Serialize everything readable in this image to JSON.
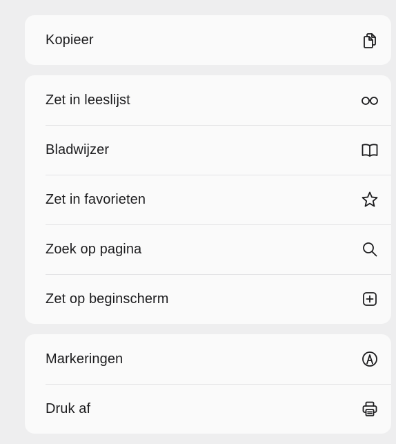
{
  "groups": [
    {
      "items": [
        {
          "label": "Kopieer",
          "icon": "copy-icon"
        }
      ]
    },
    {
      "items": [
        {
          "label": "Zet in leeslijst",
          "icon": "glasses-icon"
        },
        {
          "label": "Bladwijzer",
          "icon": "book-icon"
        },
        {
          "label": "Zet in favorieten",
          "icon": "star-icon"
        },
        {
          "label": "Zoek op pagina",
          "icon": "search-icon"
        },
        {
          "label": "Zet op beginscherm",
          "icon": "plus-square-icon"
        }
      ]
    },
    {
      "items": [
        {
          "label": "Markeringen",
          "icon": "markup-pen-icon"
        },
        {
          "label": "Druk af",
          "icon": "printer-icon"
        }
      ]
    }
  ],
  "colors": {
    "background": "#eeeeef",
    "card": "#fafafa",
    "text": "#1c1c1e",
    "separator": "#e3e3e5"
  }
}
